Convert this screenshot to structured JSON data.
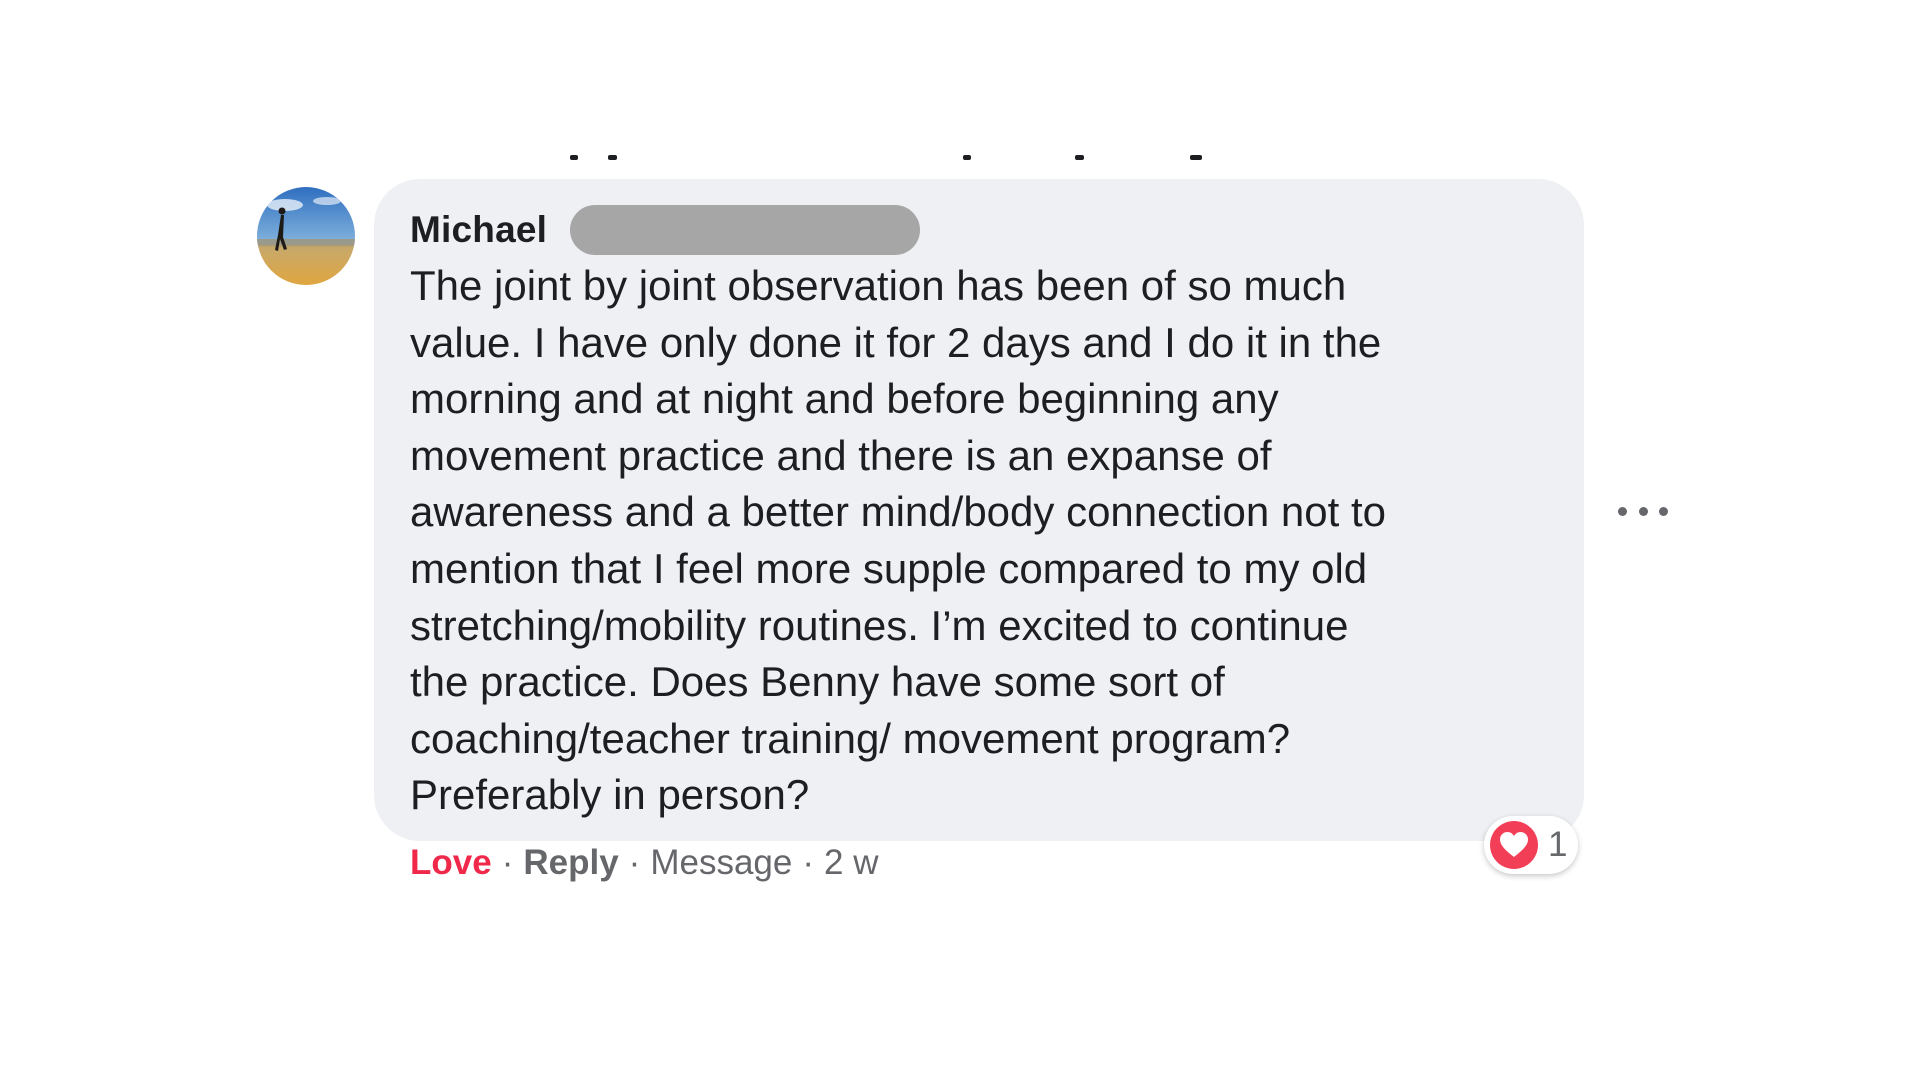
{
  "comment": {
    "author_first_name": "Michael",
    "body_lines": [
      "The joint by joint observation has been of so much",
      "value. I have only done it for 2 days and I do it in the",
      "morning and at night and before beginning any",
      "movement practice and there is an expanse of",
      "awareness and a better mind/body connection not to",
      "mention that I feel more supple compared to my old",
      "stretching/mobility routines. I’m excited to continue",
      "the practice. Does Benny have some sort of",
      "coaching/teacher training/ movement program?",
      "Preferably in person?"
    ],
    "actions": {
      "love_label": "Love",
      "reply_label": "Reply",
      "message_label": "Message",
      "timestamp": "2 w",
      "separator": "·"
    },
    "reactions": {
      "icon": "heart-icon",
      "count": "1",
      "color": "#f33e58"
    },
    "more_icon": "more-options-icon"
  },
  "colors": {
    "bubble_background": "#eef0f3",
    "love_accent": "#f0284a",
    "secondary_text": "#65676b",
    "primary_text": "#1c1e21",
    "redaction": "#a6a6a6"
  }
}
